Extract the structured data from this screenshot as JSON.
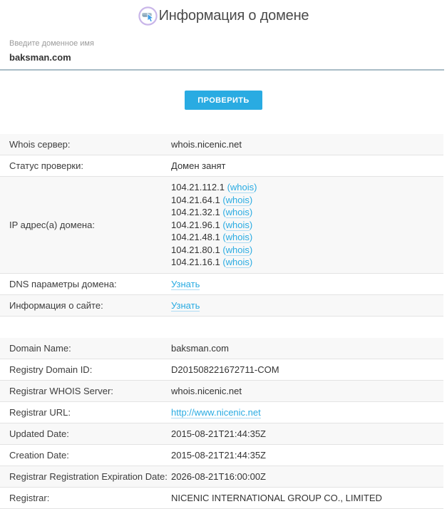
{
  "header": {
    "title": "Информация о домене",
    "icon": "domain-cursor-icon"
  },
  "colors": {
    "accent": "#29abe2",
    "link": "#29abe2",
    "row_shade_bg": "#f8f8f8",
    "row_border": "#e3e3e3",
    "input_underline": "#a9bcc6"
  },
  "punct": {
    "open": "(",
    "close": ")"
  },
  "form": {
    "label": "Введите доменное имя",
    "value": "baksman.com",
    "submit_label": "ПРОВЕРИТЬ"
  },
  "whois": {
    "rows": [
      {
        "label": "Whois сервер:",
        "value": "whois.nicenic.net"
      },
      {
        "label": "Статус проверки:",
        "value": "Домен занят"
      }
    ],
    "ip_row": {
      "label": "IP адрес(а) домена:",
      "link_label": "whois",
      "ips": [
        "104.21.112.1",
        "104.21.64.1",
        "104.21.32.1",
        "104.21.96.1",
        "104.21.48.1",
        "104.21.80.1",
        "104.21.16.1"
      ]
    },
    "dns_row": {
      "label": "DNS параметры домена:",
      "link_label": "Узнать"
    },
    "site_row": {
      "label": "Информация о сайте:",
      "link_label": "Узнать"
    }
  },
  "registry": {
    "rows": [
      {
        "label": "Domain Name:",
        "value": "baksman.com"
      },
      {
        "label": "Registry Domain ID:",
        "value": "D201508221672711-COM"
      },
      {
        "label": "Registrar WHOIS Server:",
        "value": "whois.nicenic.net"
      },
      {
        "label": "Registrar URL:",
        "value": "http://www.nicenic.net"
      },
      {
        "label": "Updated Date:",
        "value": "2015-08-21T21:44:35Z"
      },
      {
        "label": "Creation Date:",
        "value": "2015-08-21T21:44:35Z"
      },
      {
        "label": "Registrar Registration Expiration Date:",
        "value": "2026-08-21T16:00:00Z"
      },
      {
        "label": "Registrar:",
        "value": "NICENIC INTERNATIONAL GROUP CO., LIMITED"
      }
    ]
  }
}
